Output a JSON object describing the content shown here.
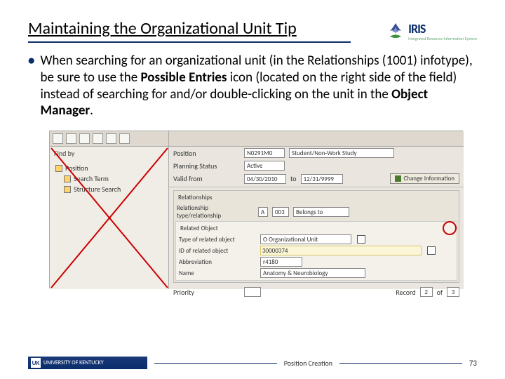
{
  "title": "Maintaining the Organizational Unit Tip",
  "bullet": {
    "pre": "When searching for an organizational unit (in the Relationships (1001) infotype), be sure to use the ",
    "bold1": "Possible Entries",
    "mid": " icon (located on the right side of the field) instead of searching for and/or double-clicking on the unit in the ",
    "bold2": "Object Manager",
    "post": "."
  },
  "left": {
    "find_by": "Find by",
    "tree": {
      "root": "Position",
      "a": "Search Term",
      "b": "Structure Search"
    }
  },
  "right": {
    "position_lbl": "Position",
    "position_val": "N0291M0",
    "position_desc": "Student/Non-Work Study",
    "planning_lbl": "Planning Status",
    "planning_val": "Active",
    "valid_lbl": "Valid from",
    "valid_from": "04/30/2010",
    "to_lbl": "to",
    "valid_to": "12/31/9999",
    "change_btn": "Change Information",
    "rel_hdr": "Relationships",
    "reltype_lbl": "Relationship type/relationship",
    "reltype_a": "A",
    "reltype_b": "003",
    "reltype_c": "Belongs to",
    "ro_hdr": "Related Object",
    "type_lbl": "Type of related object",
    "type_val": "O Organizational Unit",
    "id_lbl": "ID of related object",
    "id_val": "30000374",
    "abbr_lbl": "Abbreviation",
    "abbr_val": "r4180",
    "name_lbl": "Name",
    "name_val": "Anatomy & Neurobiology",
    "prio_lbl": "Priority",
    "rec_lbl": "Record",
    "rec_a": "2",
    "rec_of": "of",
    "rec_b": "3"
  },
  "logo": {
    "name": "IRIS",
    "sub": "Integrated Resource Information System"
  },
  "footer": {
    "brand_letters": "UK",
    "brand": "UNIVERSITY OF KENTUCKY",
    "center": "Position Creation",
    "page": "73"
  }
}
